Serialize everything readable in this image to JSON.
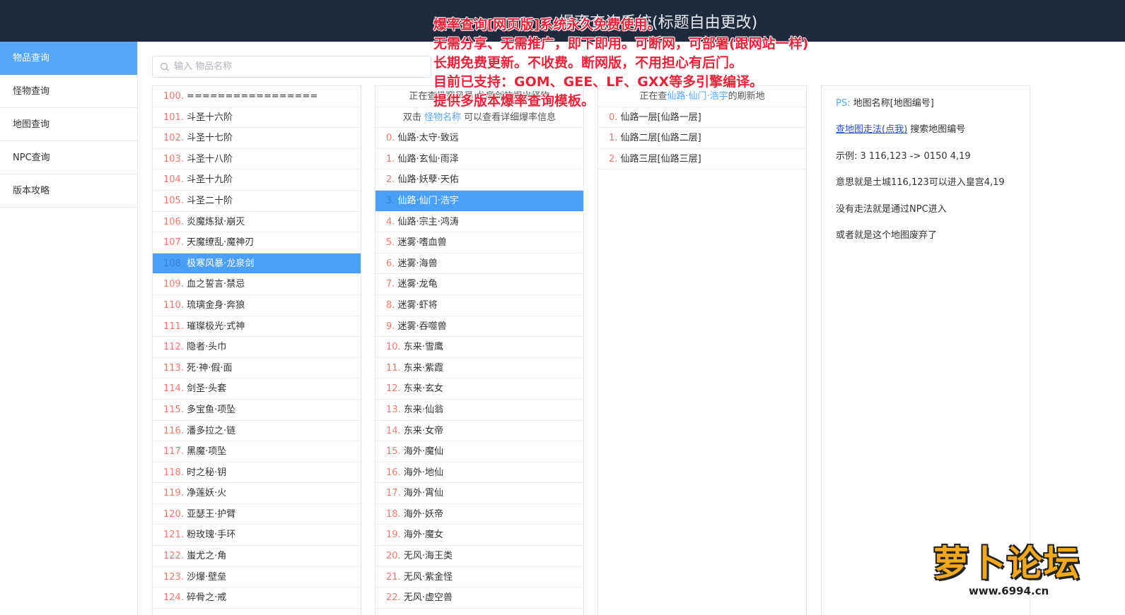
{
  "header": {
    "title": "爆率查询系统(标题自由更改)"
  },
  "sidebar": {
    "items": [
      {
        "label": "物品查询"
      },
      {
        "label": "怪物查询"
      },
      {
        "label": "地图查询"
      },
      {
        "label": "NPC查询"
      },
      {
        "label": "版本攻略"
      }
    ]
  },
  "search": {
    "placeholder": "输入 物品名称",
    "value": ""
  },
  "items_list": {
    "rows": [
      {
        "idx": "100.",
        "name": " ================="
      },
      {
        "idx": "101.",
        "name": " 斗圣十六阶"
      },
      {
        "idx": "102.",
        "name": " 斗圣十七阶"
      },
      {
        "idx": "103.",
        "name": " 斗圣十八阶"
      },
      {
        "idx": "104.",
        "name": " 斗圣十九阶"
      },
      {
        "idx": "105.",
        "name": " 斗圣二十阶"
      },
      {
        "idx": "106.",
        "name": " 炎魔炼狱·崩灭"
      },
      {
        "idx": "107.",
        "name": " 天魔缭乱·魔神刃"
      },
      {
        "idx": "108.",
        "name": " 极寒风暴·龙泉剑"
      },
      {
        "idx": "109.",
        "name": " 血之誓言·禁忌"
      },
      {
        "idx": "110.",
        "name": " 琉璃金身·奔狼"
      },
      {
        "idx": "111.",
        "name": " 璀璨极光·式神"
      },
      {
        "idx": "112.",
        "name": " 隐者·头巾"
      },
      {
        "idx": "113.",
        "name": " 死·神·假·面"
      },
      {
        "idx": "114.",
        "name": " 剑圣·头套"
      },
      {
        "idx": "115.",
        "name": " 多宝鱼·项坠"
      },
      {
        "idx": "116.",
        "name": " 潘多拉之·链"
      },
      {
        "idx": "117.",
        "name": " 黑魔·项坠"
      },
      {
        "idx": "118.",
        "name": " 时之秘·钥"
      },
      {
        "idx": "119.",
        "name": " 净莲妖·火"
      },
      {
        "idx": "120.",
        "name": " 亚瑟王·护臂"
      },
      {
        "idx": "121.",
        "name": " 粉玫瑰·手环"
      },
      {
        "idx": "122.",
        "name": " 蚩尤之·角"
      },
      {
        "idx": "123.",
        "name": " 沙爆·壁垒"
      },
      {
        "idx": "124.",
        "name": " 碎骨之·戒"
      }
    ]
  },
  "monsters_list": {
    "head1": "正在查极寒风暴·龙泉剑的爆出怪物",
    "head2_prefix": "双击",
    "head2_hl": "怪物名称",
    "head2_suffix": "可以查看详细爆率信息",
    "rows": [
      {
        "idx": "0.",
        "name": " 仙路·太守·致远"
      },
      {
        "idx": "1.",
        "name": " 仙路·玄仙·雨泽"
      },
      {
        "idx": "2.",
        "name": " 仙路·妖孽·天佑"
      },
      {
        "idx": "3.",
        "name": " 仙路·仙门·浩宇"
      },
      {
        "idx": "4.",
        "name": " 仙路·宗主·鸿涛"
      },
      {
        "idx": "5.",
        "name": " 迷雾·嗜血兽"
      },
      {
        "idx": "6.",
        "name": " 迷雾·海兽"
      },
      {
        "idx": "7.",
        "name": " 迷雾·龙龟"
      },
      {
        "idx": "8.",
        "name": " 迷雾·虾将"
      },
      {
        "idx": "9.",
        "name": " 迷雾·吞噬兽"
      },
      {
        "idx": "10.",
        "name": " 东来·雪鹰"
      },
      {
        "idx": "11.",
        "name": " 东来·紫霞"
      },
      {
        "idx": "12.",
        "name": " 东来·玄女"
      },
      {
        "idx": "13.",
        "name": " 东来·仙翁"
      },
      {
        "idx": "14.",
        "name": " 东来·女帝"
      },
      {
        "idx": "15.",
        "name": " 海外·魔仙"
      },
      {
        "idx": "16.",
        "name": " 海外·地仙"
      },
      {
        "idx": "17.",
        "name": " 海外·霄仙"
      },
      {
        "idx": "18.",
        "name": " 海外·妖帝"
      },
      {
        "idx": "19.",
        "name": " 海外·魔女"
      },
      {
        "idx": "20.",
        "name": " 无风·海王类"
      },
      {
        "idx": "21.",
        "name": " 无风·紫金怪"
      },
      {
        "idx": "22.",
        "name": " 无风·虚空兽"
      }
    ]
  },
  "maps_list": {
    "head_prefix": "正在查",
    "head_hl": "仙路·仙门·浩宇",
    "head_suffix": "的刷新地",
    "rows": [
      {
        "idx": "0.",
        "name": " 仙路一层[仙路一层]"
      },
      {
        "idx": "1.",
        "name": " 仙路二层[仙路二层]"
      },
      {
        "idx": "2.",
        "name": " 仙路三层[仙路三层]"
      }
    ]
  },
  "info": {
    "ps_label": "PS:",
    "ps_text": " 地图名称[地图编号]",
    "link_text": "查地图走法(点我)",
    "link_suffix": " 搜索地图编号",
    "example": "示例:  3 116,123 -> 0150 4,19",
    "meaning": "意思就是土城116,123可以进入皇宫4,19",
    "no_route": "没有走法就是通过NPC进入",
    "abandoned": "或者就是这个地图废弃了"
  },
  "overlay": {
    "lines": [
      "爆率查询[网页版]系统永久免费使用。",
      "无需分享、无需推广，即下即用。可断网，可部署(跟网站一样)",
      "长期免费更新。不收费。断网版，不用担心有后门。",
      "目前已支持：GOM、GEE、LF、GXX等多引擎编译。",
      "提供多版本爆率查询模板。"
    ]
  },
  "watermark": {
    "word": "萝卜论坛",
    "url": "www.6994.cn"
  },
  "colors": {
    "accent": "#55a6f7",
    "index": "#f2786d",
    "overlay": "#e6233a",
    "header_bg": "#202a3f"
  }
}
